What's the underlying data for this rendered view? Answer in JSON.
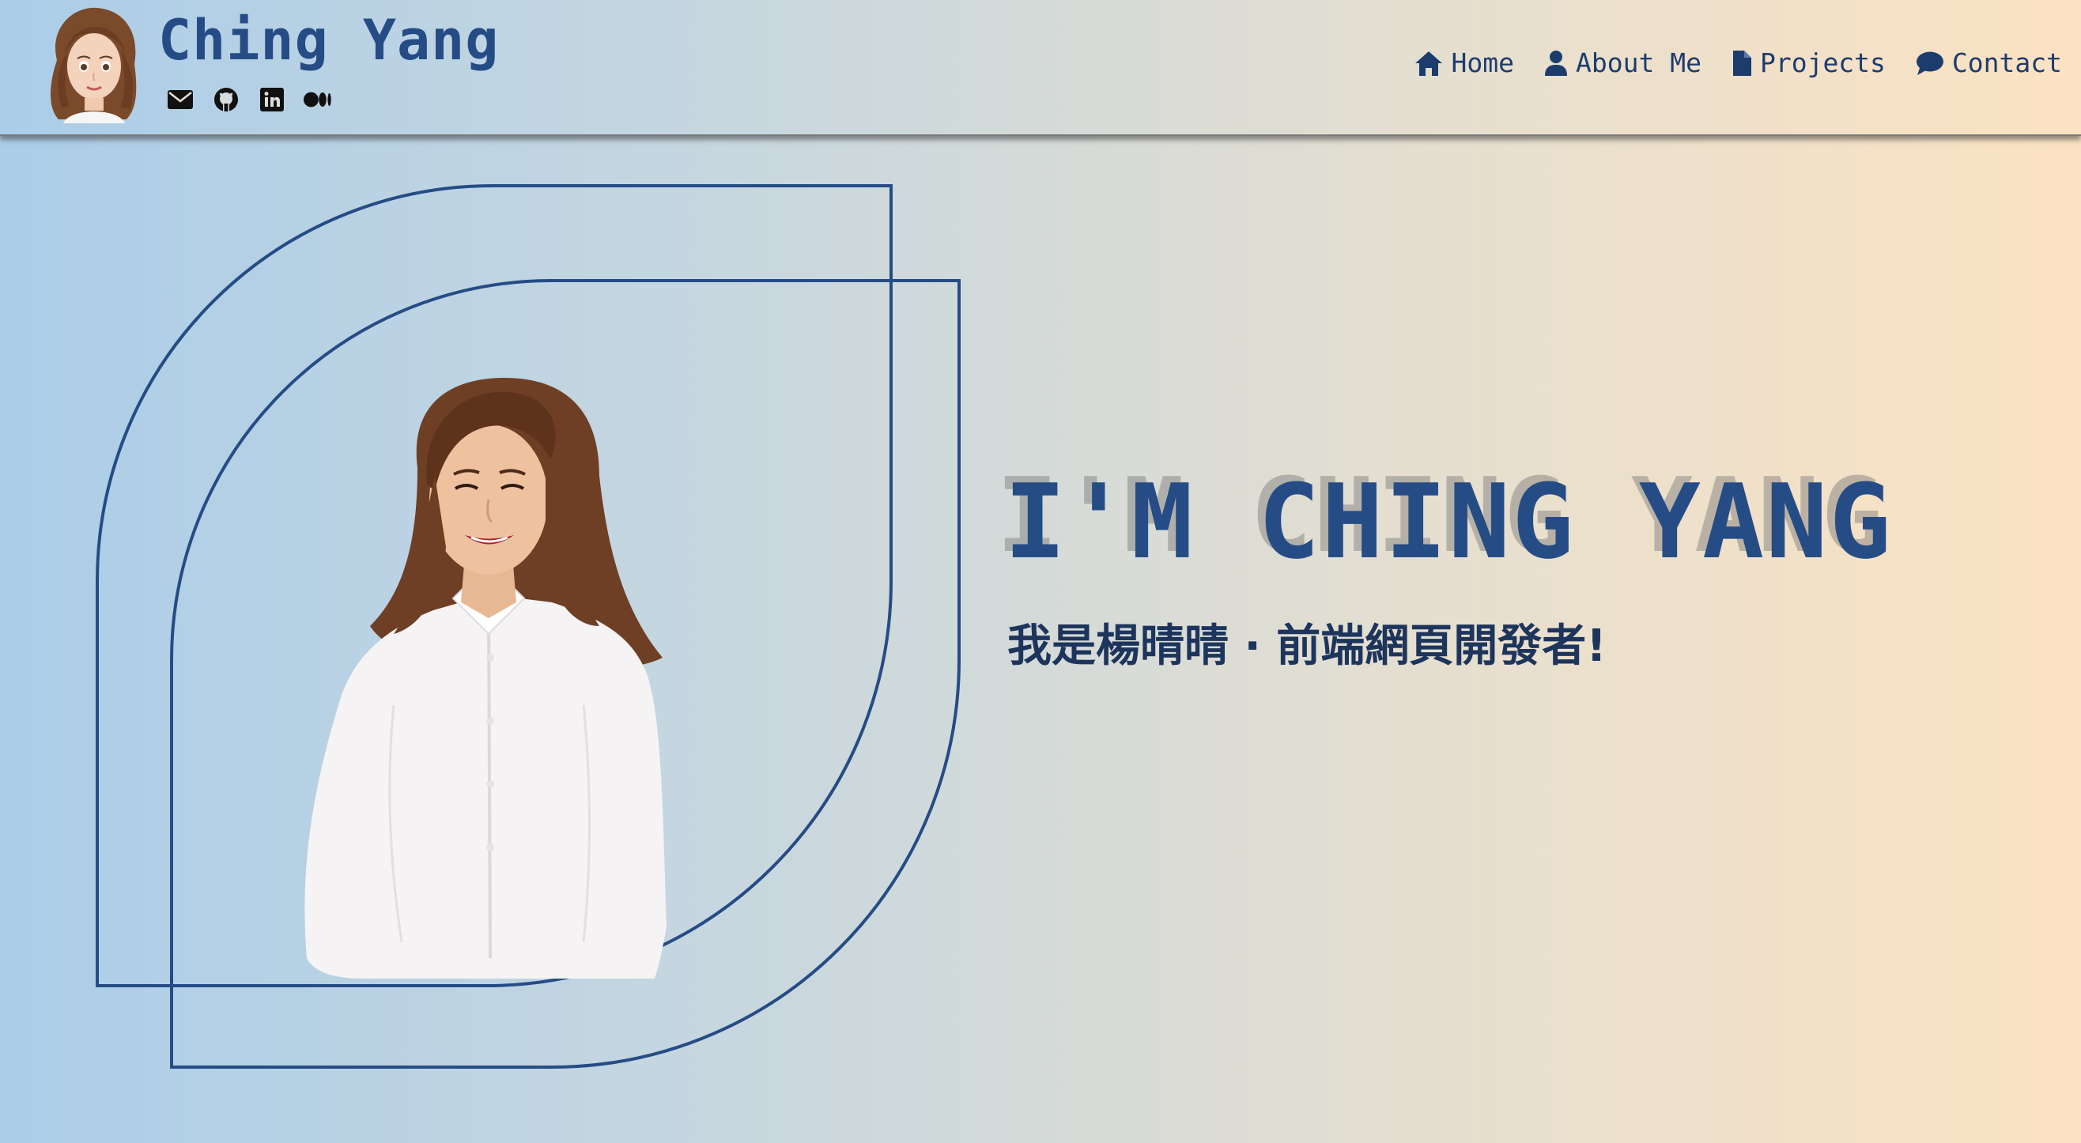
{
  "header": {
    "brand_name": "Ching Yang",
    "socials": [
      {
        "icon": "envelope-icon"
      },
      {
        "icon": "github-icon"
      },
      {
        "icon": "linkedin-icon"
      },
      {
        "icon": "medium-icon"
      }
    ],
    "nav": [
      {
        "label": "Home",
        "icon": "home-icon"
      },
      {
        "label": "About Me",
        "icon": "user-icon"
      },
      {
        "label": "Projects",
        "icon": "file-icon"
      },
      {
        "label": "Contact",
        "icon": "comment-icon"
      }
    ]
  },
  "hero": {
    "title": "I'M CHING YANG",
    "subtitle": "我是楊晴晴 · 前端網頁開發者!"
  },
  "colors": {
    "primary": "#264c86",
    "nav_text": "#1d3c6e",
    "gradient_left": "#abcde8",
    "gradient_right": "#fbe2c2"
  }
}
